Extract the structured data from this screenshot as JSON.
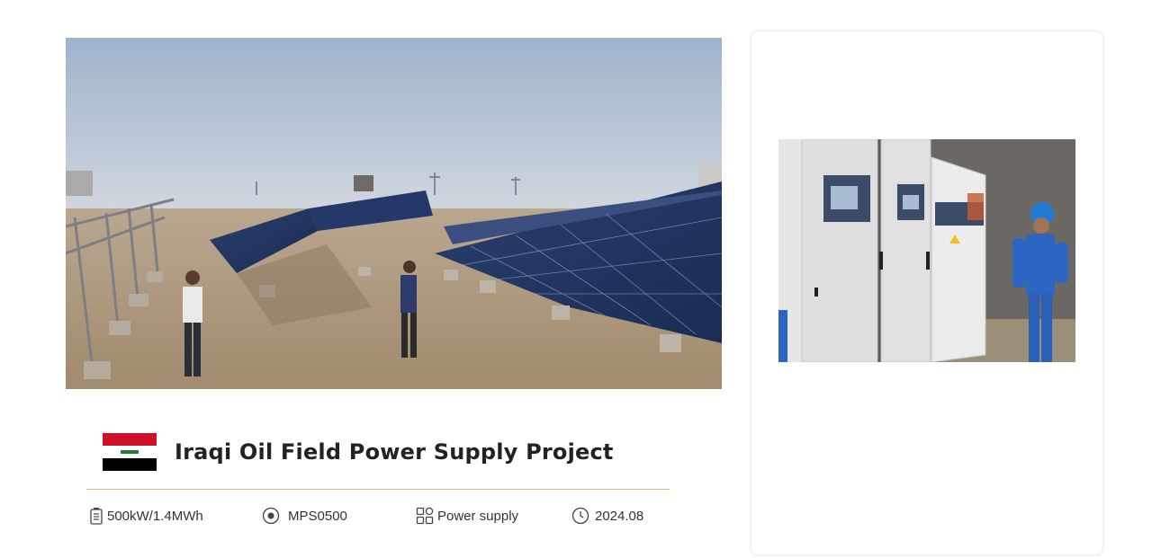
{
  "project": {
    "title": "Iraqi Oil Field Power Supply Project",
    "flag_icon": "iraq-flag-icon"
  },
  "specs": [
    {
      "icon": "battery-icon",
      "label": "500kW/1.4MWh"
    },
    {
      "icon": "model-disc-icon",
      "label": "MPS0500"
    },
    {
      "icon": "grid-icon",
      "label": "Power supply"
    },
    {
      "icon": "clock-icon",
      "label": "2024.08"
    }
  ],
  "colors": {
    "divider": "#e4b677",
    "title": "#222222",
    "flag_red": "#ce1126",
    "flag_black": "#000000"
  }
}
